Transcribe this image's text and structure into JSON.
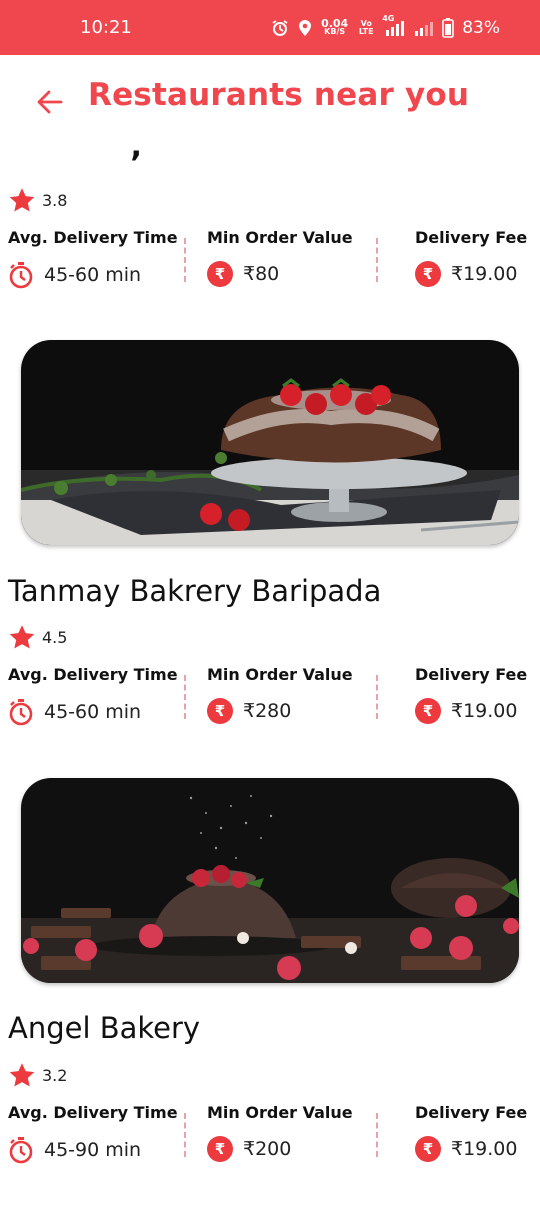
{
  "status_bar": {
    "time": "10:21",
    "data_speed": "0.04",
    "data_unit": "KB/S",
    "volte": "Vo LTE",
    "network": "4G",
    "battery": "83%"
  },
  "header": {
    "title": "Restaurants near you"
  },
  "labels": {
    "avg_delivery": "Avg. Delivery Time",
    "min_order": "Min Order Value",
    "delivery_fee": "Delivery Fee"
  },
  "restaurants": [
    {
      "name": "’",
      "rating": "3.8",
      "delivery_time": "45-60 min",
      "min_order": "₹80",
      "fee": "₹19.00"
    },
    {
      "name": "Tanmay Bakrery Baripada",
      "rating": "4.5",
      "delivery_time": "45-60 min",
      "min_order": "₹280",
      "fee": "₹19.00"
    },
    {
      "name": "Angel Bakery",
      "rating": "3.2",
      "delivery_time": "45-90 min",
      "min_order": "₹200",
      "fee": "₹19.00"
    }
  ],
  "colors": {
    "accent": "#f0474e",
    "badge": "#ec3a3f",
    "divider": "#e9a3a6"
  }
}
